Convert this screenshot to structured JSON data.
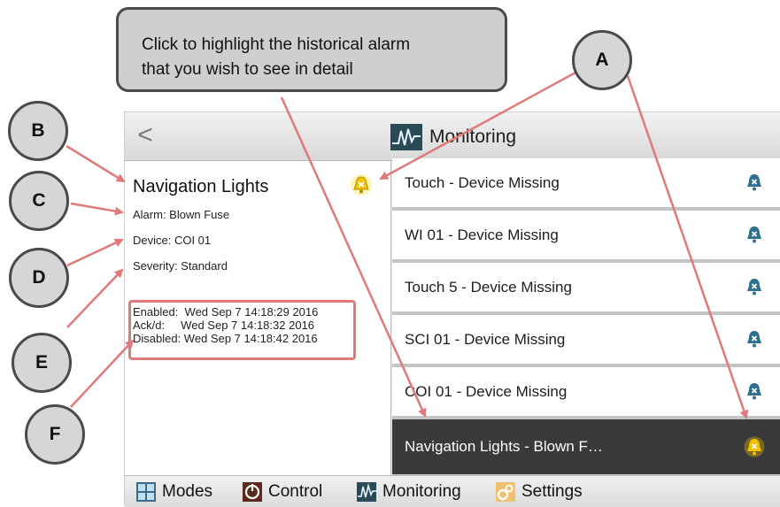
{
  "callout": {
    "line1": "Click to highlight the historical alarm",
    "line2": "that you wish to see in detail"
  },
  "badges": {
    "a": "A",
    "b": "B",
    "c": "C",
    "d": "D",
    "e": "E",
    "f": "F"
  },
  "titlebar": {
    "back_label": "<",
    "title": "Monitoring"
  },
  "detail": {
    "title": "Navigation Lights",
    "alarm": "Alarm: Blown Fuse",
    "device": "Device: COI 01",
    "severity": "Severity: Standard",
    "enabled": "Enabled:  Wed Sep 7 14:18:29 2016",
    "ackd": "Ack/d:     Wed Sep 7 14:18:32 2016",
    "disabled": "Disabled: Wed Sep 7 14:18:42 2016"
  },
  "alarms": [
    {
      "label": "Touch - Device Missing"
    },
    {
      "label": "WI 01 - Device Missing"
    },
    {
      "label": "Touch 5 - Device Missing"
    },
    {
      "label": "SCI 01 - Device Missing"
    },
    {
      "label": "COI 01 - Device Missing"
    },
    {
      "label": "Navigation Lights - Blown F…"
    }
  ],
  "nav": {
    "modes": "Modes",
    "control": "Control",
    "monitoring": "Monitoring",
    "settings": "Settings"
  },
  "colors": {
    "annotation_red": "#e07a7a",
    "bell_blue": "#2f6f8f",
    "bell_yellow": "#f2c200",
    "selected_row": "#3a3a3a"
  }
}
